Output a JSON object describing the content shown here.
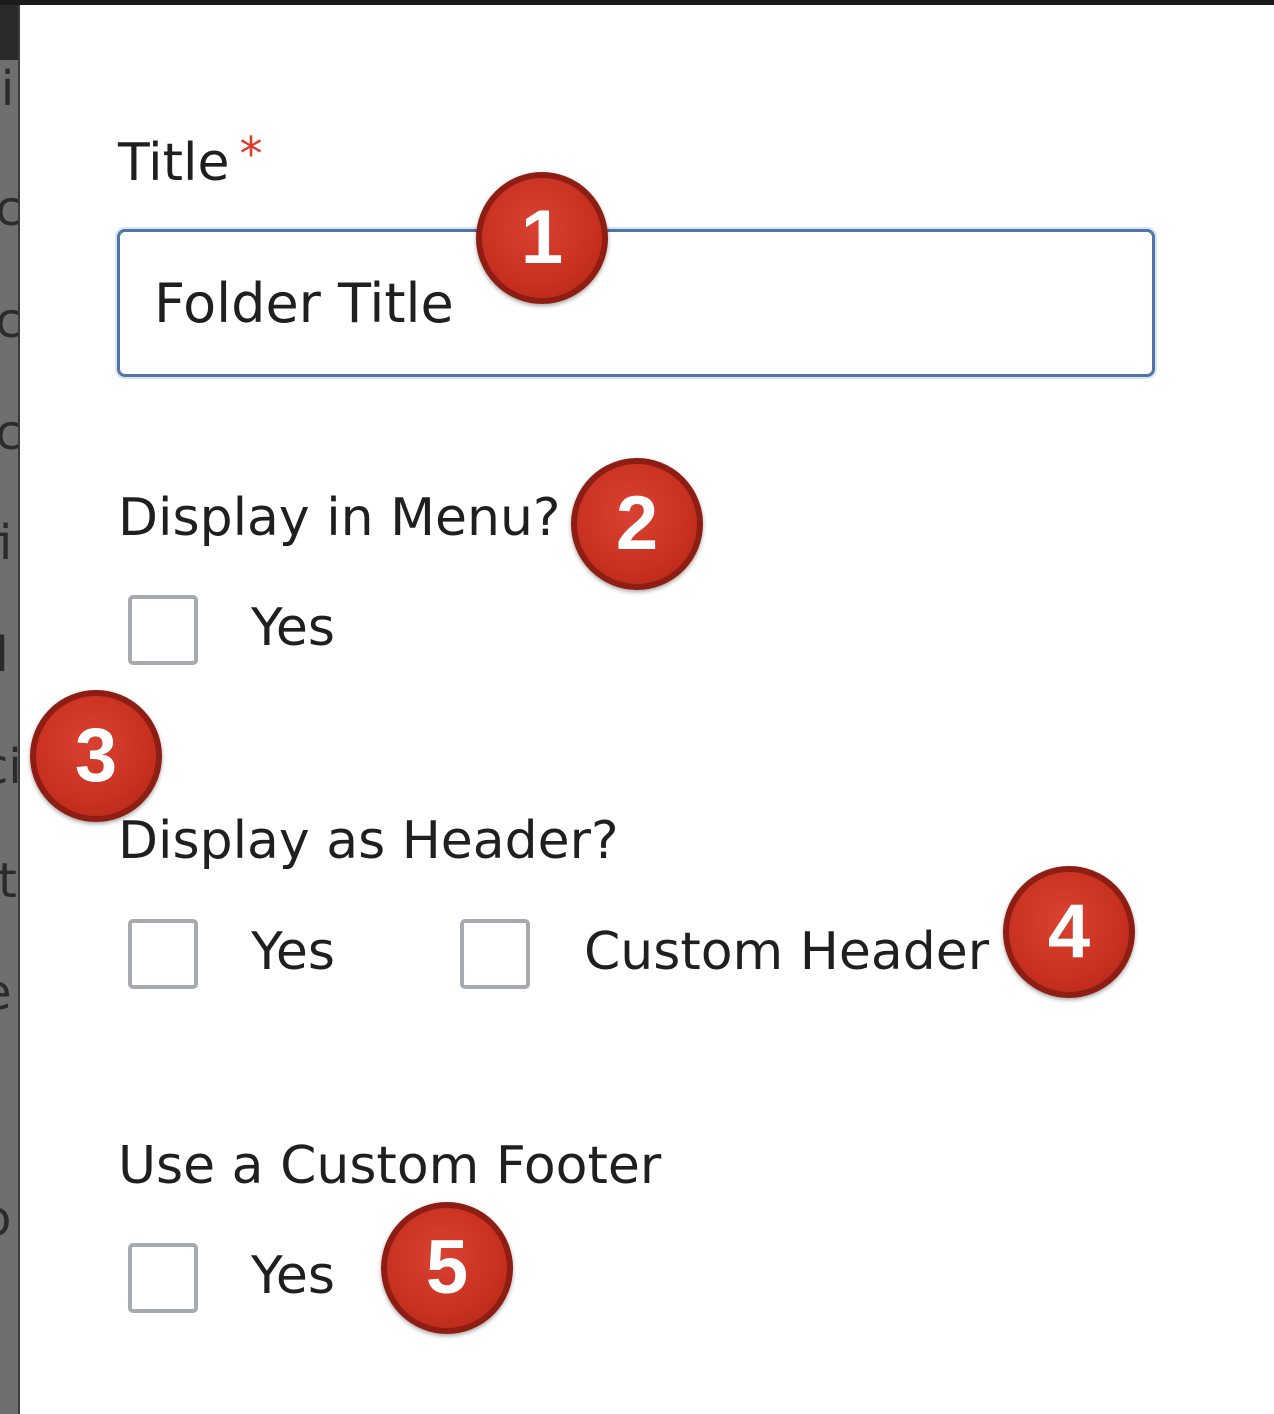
{
  "background_text_fragments": [
    "ti",
    "ic",
    "ic",
    "ic",
    "fi",
    "il",
    "ci",
    "ft",
    "e",
    "o"
  ],
  "form": {
    "title_label": "Title",
    "required_marker": "*",
    "title_value": "Folder Title",
    "display_in_menu": {
      "label": "Display in Menu?",
      "options": [
        {
          "label": "Yes",
          "checked": false
        }
      ]
    },
    "display_as_header": {
      "label": "Display as Header?",
      "options": [
        {
          "label": "Yes",
          "checked": false
        },
        {
          "label": "Custom Header",
          "checked": false
        }
      ]
    },
    "custom_footer": {
      "label": "Use a Custom Footer",
      "options": [
        {
          "label": "Yes",
          "checked": false
        }
      ]
    }
  },
  "callouts": [
    "1",
    "2",
    "3",
    "4",
    "5"
  ],
  "colors": {
    "callout_fill": "#c8301f",
    "required_star": "#e03a2c",
    "input_border": "#4f76a8",
    "checkbox_border": "#a7aab0"
  }
}
